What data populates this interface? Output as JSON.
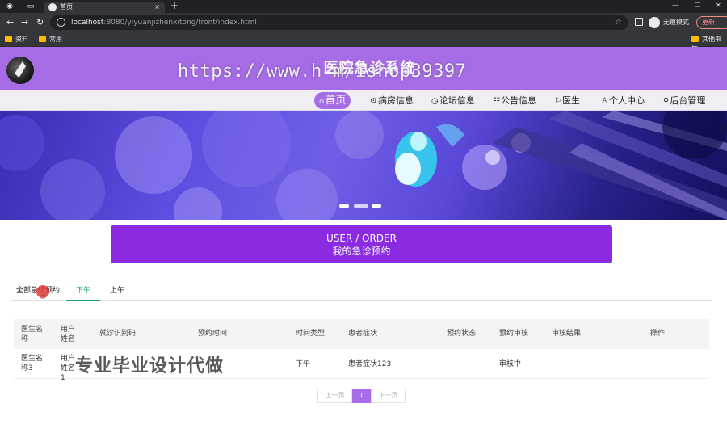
{
  "browser": {
    "tab_title": "首页",
    "tab_close": "×",
    "new_tab": "+",
    "url_host": "localhost",
    "url_path": ":8080/yiyuanjizhenxitong/front/index.html",
    "incognito_label": "无痕模式",
    "update_label": "更新",
    "bookmarks": [
      "资料",
      "常用",
      "其他书签"
    ],
    "window_controls": [
      "—",
      "❐",
      "✕"
    ]
  },
  "site": {
    "title": "医院急诊系统",
    "watermark_url": "https://www.h           m/ishop39397",
    "watermark_cn": "专业毕业设计代做"
  },
  "nav": {
    "items": [
      {
        "icon": "⌂",
        "label": "首页"
      },
      {
        "icon": "⚙",
        "label": "病房信息"
      },
      {
        "icon": "◷",
        "label": "论坛信息"
      },
      {
        "icon": "☷",
        "label": "公告信息"
      },
      {
        "icon": "⚐",
        "label": "医生"
      },
      {
        "icon": "♙",
        "label": "个人中心"
      },
      {
        "icon": "⚲",
        "label": "后台管理"
      }
    ]
  },
  "colors": {
    "brand": "#a56ce6",
    "order_button": "#8a2be2",
    "active_tab": "#1aa078"
  },
  "order": {
    "line1": "USER / ORDER",
    "line2": "我的急诊预约"
  },
  "filter_tabs": {
    "all": "全部急诊预约",
    "afternoon": "下午",
    "morning": "上午"
  },
  "table": {
    "headers": [
      "医生名称",
      "用户姓名",
      "就诊识别码",
      "预约时间",
      "时间类型",
      "患者症状",
      "预约状态",
      "预约审核",
      "审核结果",
      "操作"
    ],
    "rows": [
      {
        "doctor": "医生名称3",
        "user": "用户姓名1",
        "code": "",
        "time": "",
        "type": "下午",
        "symptom": "患者症状123",
        "status": "",
        "review": "审核中",
        "result": "",
        "action": ""
      }
    ]
  },
  "pagination": {
    "prev": "上一页",
    "current": "1",
    "next": "下一页"
  }
}
